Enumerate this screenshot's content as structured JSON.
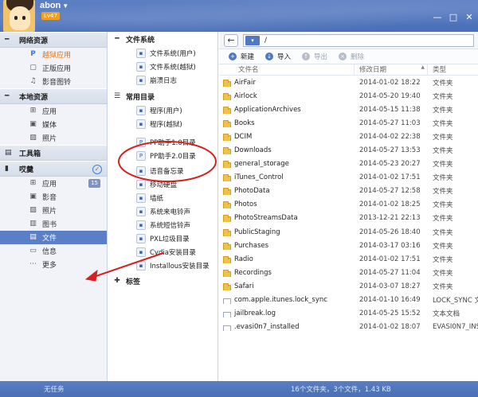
{
  "user": {
    "name": "abon",
    "level": "Lv47"
  },
  "window": {
    "buttons": [
      "—",
      "□",
      "✕"
    ]
  },
  "sidebar": {
    "groups": [
      {
        "title": "网络资源",
        "items": [
          {
            "label": "越狱应用",
            "icon": "pp-icon"
          },
          {
            "label": "正版应用",
            "icon": "app-icon"
          },
          {
            "label": "影音图铃",
            "icon": "music-icon"
          }
        ]
      },
      {
        "title": "本地资源",
        "items": [
          {
            "label": "应用",
            "icon": "grid-icon"
          },
          {
            "label": "媒体",
            "icon": "media-icon"
          },
          {
            "label": "照片",
            "icon": "photo-icon"
          }
        ]
      },
      {
        "title": "工具箱",
        "items": []
      },
      {
        "title": "哎羹",
        "items": [
          {
            "label": "应用",
            "icon": "grid-icon",
            "badge": "15"
          },
          {
            "label": "影音",
            "icon": "media-icon"
          },
          {
            "label": "照片",
            "icon": "photo-icon"
          },
          {
            "label": "图书",
            "icon": "book-icon"
          },
          {
            "label": "文件",
            "icon": "file-icon"
          },
          {
            "label": "信息",
            "icon": "message-icon"
          },
          {
            "label": "更多",
            "icon": "more-icon"
          }
        ]
      }
    ]
  },
  "tree": {
    "section1": "文件系统",
    "fs_items": [
      "文件系统(用户)",
      "文件系统(越狱)",
      "崩溃日志"
    ],
    "section2": "常用目录",
    "dir_items": [
      "程序(用户)",
      "程序(越狱)",
      "PP助手1.0目录",
      "PP助手2.0目录",
      "语音备忘录",
      "移动硬盘",
      "墙纸",
      "系统来电铃声",
      "系统短信铃声",
      "PXL垃圾目录",
      "Cydia安装目录",
      "Installous安装目录"
    ],
    "section3": "标签"
  },
  "main": {
    "path": "/",
    "toolbar": {
      "new": "新建",
      "import": "导入",
      "export": "导出",
      "delete": "删除"
    },
    "columns": {
      "name": "文件名",
      "date": "修改日期",
      "type": "类型"
    },
    "files": [
      {
        "name": "AirFair",
        "date": "2014-01-02 18:22",
        "type": "文件夹",
        "kind": "folder"
      },
      {
        "name": "Airlock",
        "date": "2014-05-20 19:40",
        "type": "文件夹",
        "kind": "folder"
      },
      {
        "name": "ApplicationArchives",
        "date": "2014-05-15 11:38",
        "type": "文件夹",
        "kind": "folder"
      },
      {
        "name": "Books",
        "date": "2014-05-27 11:03",
        "type": "文件夹",
        "kind": "folder"
      },
      {
        "name": "DCIM",
        "date": "2014-04-02 22:38",
        "type": "文件夹",
        "kind": "folder"
      },
      {
        "name": "Downloads",
        "date": "2014-05-27 13:53",
        "type": "文件夹",
        "kind": "folder"
      },
      {
        "name": "general_storage",
        "date": "2014-05-23 20:27",
        "type": "文件夹",
        "kind": "folder"
      },
      {
        "name": "iTunes_Control",
        "date": "2014-01-02 17:51",
        "type": "文件夹",
        "kind": "folder"
      },
      {
        "name": "PhotoData",
        "date": "2014-05-27 12:58",
        "type": "文件夹",
        "kind": "folder"
      },
      {
        "name": "Photos",
        "date": "2014-01-02 18:25",
        "type": "文件夹",
        "kind": "folder"
      },
      {
        "name": "PhotoStreamsData",
        "date": "2013-12-21 22:13",
        "type": "文件夹",
        "kind": "folder"
      },
      {
        "name": "PublicStaging",
        "date": "2014-05-26 18:40",
        "type": "文件夹",
        "kind": "folder"
      },
      {
        "name": "Purchases",
        "date": "2014-03-17 03:16",
        "type": "文件夹",
        "kind": "folder"
      },
      {
        "name": "Radio",
        "date": "2014-01-02 17:51",
        "type": "文件夹",
        "kind": "folder"
      },
      {
        "name": "Recordings",
        "date": "2014-05-27 11:04",
        "type": "文件夹",
        "kind": "folder"
      },
      {
        "name": "Safari",
        "date": "2014-03-07 18:27",
        "type": "文件夹",
        "kind": "folder"
      },
      {
        "name": "com.apple.itunes.lock_sync",
        "date": "2014-01-10 16:49",
        "type": "LOCK_SYNC 文",
        "kind": "file"
      },
      {
        "name": "jailbreak.log",
        "date": "2014-05-25 15:52",
        "type": "文本文档",
        "kind": "file"
      },
      {
        "name": ".evasi0n7_installed",
        "date": "2014-01-02 18:07",
        "type": "EVASI0N7_INS",
        "kind": "file"
      }
    ]
  },
  "status": {
    "task": "无任务",
    "summary": "16个文件夹，3个文件，1.43 KB"
  },
  "colors": {
    "accent": "#4f79c4",
    "highlight": "#e7700d",
    "annotation": "#d6201e",
    "active_row": "#5a7fc7"
  }
}
